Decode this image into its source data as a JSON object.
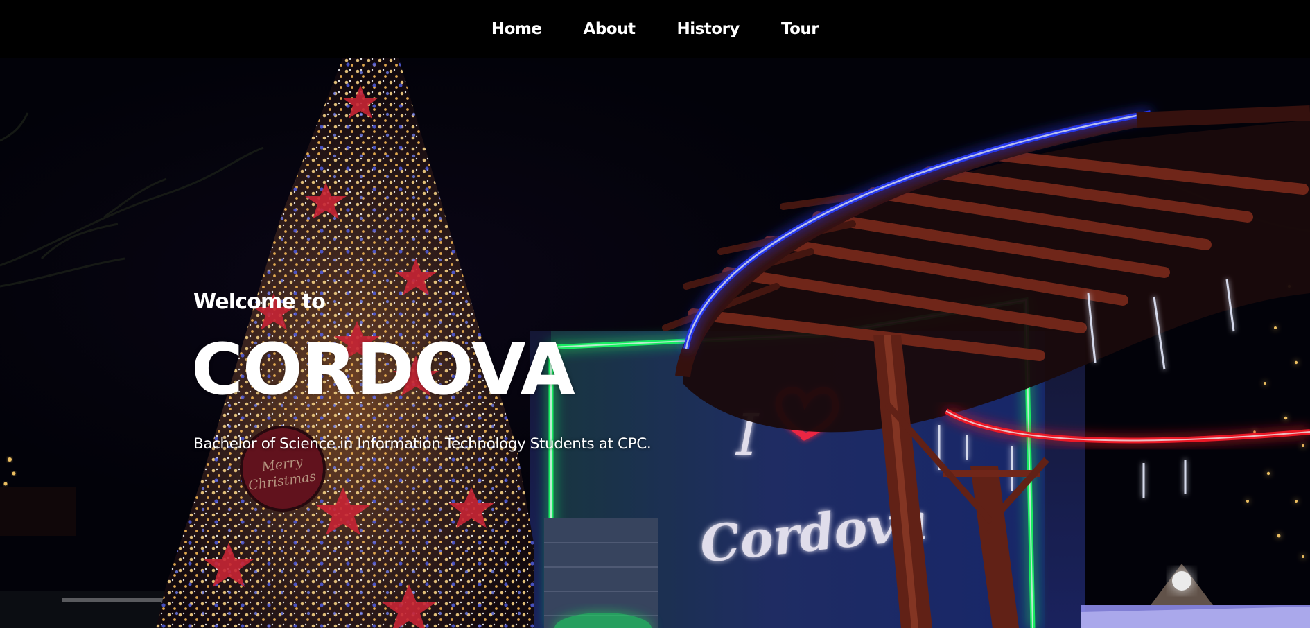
{
  "nav": {
    "items": [
      {
        "label": "Home"
      },
      {
        "label": "About"
      },
      {
        "label": "History"
      },
      {
        "label": "Tour"
      }
    ]
  },
  "hero": {
    "welcome": "Welcome to",
    "title": "CORDOVA",
    "subtitle": "Bachelor of Science in Information Technology Students at CPC.",
    "background": {
      "sign_line1": "I",
      "sign_line2": "Cordova",
      "ornament_text_1": "Merry",
      "ornament_text_2": "Christmas"
    },
    "colors": {
      "sky": "#03030a",
      "neon_blue": "#2a3cff",
      "neon_green": "#1fff6a",
      "neon_red": "#ff1a2a",
      "gazebo_wood": "#7a2a1c",
      "tree_lights": "#ffcf6a",
      "sign_white": "#f4f0ff",
      "sign_heart": "#ff2a48"
    }
  }
}
